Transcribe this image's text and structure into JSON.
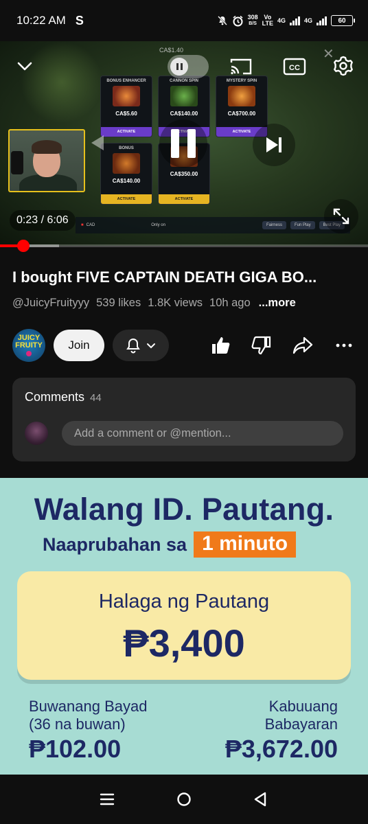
{
  "status_bar": {
    "time": "10:22 AM",
    "app_letter": "S",
    "net_speed_value": "308",
    "net_speed_unit": "B/S",
    "volte_top": "Vo",
    "volte_bottom": "LTE",
    "sim1": "4G",
    "sim2": "4G",
    "battery": "60"
  },
  "player": {
    "time_current": "0:23",
    "time_total": "6:06",
    "time_display": "0:23 / 6:06",
    "progress_fraction": 0.063,
    "buffer_fraction": 0.16,
    "game": {
      "top_price": "CA$1.40",
      "cards": [
        {
          "title": "BONUS ENHANCER",
          "price": "CA$5.60",
          "button": "ACTIVATE"
        },
        {
          "title": "CANNON SPIN",
          "price": "CA$140.00",
          "button": "ACTIVATE"
        },
        {
          "title": "MYSTERY SPIN",
          "price": "CA$700.00",
          "button": "ACTIVATE"
        },
        {
          "title": "BONUS",
          "price": "CA$140.00",
          "button": "ACTIVATE"
        },
        {
          "title": "",
          "price": "CA$350.00",
          "button": "ACTIVATE"
        }
      ],
      "footer_currency": "CAD",
      "footer_only_on": "Only on",
      "footer_fairness": "Fairness",
      "footer_fun_play": "Fun Play",
      "footer_best_play": "Best Play"
    }
  },
  "video": {
    "title": "I bought FIVE CAPTAIN DEATH GIGA BO...",
    "channel_handle": "@JuicyFruityyy",
    "likes": "539 likes",
    "views": "1.8K views",
    "age": "10h ago",
    "more": "...more"
  },
  "channel": {
    "avatar_line1": "JUICY",
    "avatar_line2": "FRUITY",
    "join_label": "Join"
  },
  "comments": {
    "title": "Comments",
    "count": "44",
    "placeholder": "Add a comment or @mention..."
  },
  "ad": {
    "headline": "Walang ID. Pautang.",
    "sub_text": "Naaprubahan sa",
    "sub_highlight": "1 minuto",
    "loan_label": "Halaga ng Pautang",
    "loan_amount": "₱3,400",
    "monthly_label_1": "Buwanang Bayad",
    "monthly_label_2": "(36 na buwan)",
    "monthly_value": "₱102.00",
    "total_label_1": "Kabuuang",
    "total_label_2": "Babayaran",
    "total_value": "₱3,672.00"
  },
  "colors": {
    "accent_red": "#ff0000",
    "ad_bg": "#a7dcd3",
    "ad_navy": "#1d2864",
    "ad_orange": "#f07a1a",
    "ad_card": "#f9eaa6"
  },
  "icons": {
    "collapse": "chevron-down-icon",
    "autoplay": "autoplay-toggle-icon",
    "cast": "cast-icon",
    "captions": "closed-captions-icon",
    "settings": "gear-icon",
    "previous": "skip-previous-icon",
    "pause": "pause-icon",
    "next": "skip-next-icon",
    "fullscreen": "fullscreen-icon",
    "bell": "bell-icon",
    "like": "thumbs-up-icon",
    "dislike": "thumbs-down-icon",
    "share": "share-icon",
    "more": "more-horizontal-icon",
    "nav_recents": "recents-icon",
    "nav_home": "home-icon",
    "nav_back": "back-icon"
  }
}
